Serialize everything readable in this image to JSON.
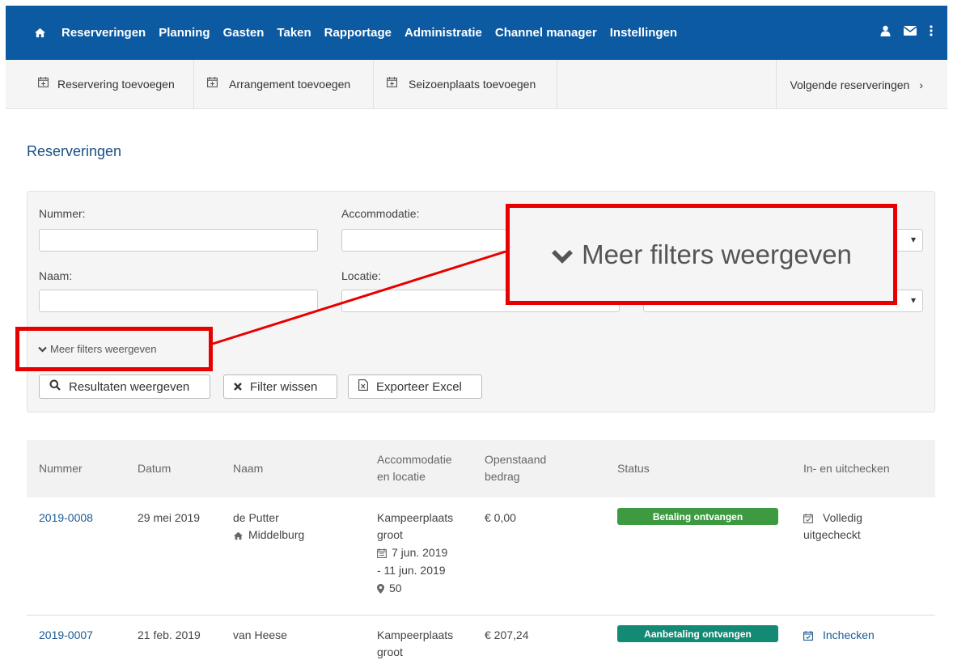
{
  "nav": {
    "items": [
      "Reserveringen",
      "Planning",
      "Gasten",
      "Taken",
      "Rapportage",
      "Administratie",
      "Channel manager",
      "Instellingen"
    ]
  },
  "toolbar": {
    "add_reservation": "Reservering toevoegen",
    "add_arrangement": "Arrangement toevoegen",
    "add_season_place": "Seizoenplaats toevoegen",
    "next_reservations": "Volgende reserveringen"
  },
  "page": {
    "title": "Reserveringen"
  },
  "filters": {
    "nummer_label": "Nummer:",
    "accommodatie_label": "Accommodatie:",
    "naam_label": "Naam:",
    "locatie_label": "Locatie:",
    "more_filters": "Meer filters weergeven",
    "show_results": "Resultaten weergeven",
    "clear_filter": "Filter wissen",
    "export_excel": "Exporteer Excel"
  },
  "callout": {
    "text": "Meer filters weergeven"
  },
  "table": {
    "headers": {
      "nummer": "Nummer",
      "datum": "Datum",
      "naam": "Naam",
      "accommodatie_1": "Accommodatie",
      "accommodatie_2": "en locatie",
      "openstaand_1": "Openstaand",
      "openstaand_2": "bedrag",
      "status": "Status",
      "checkin": "In- en uitchecken"
    },
    "rows": [
      {
        "nummer": "2019-0008",
        "datum": "29 mei 2019",
        "naam": "de Putter",
        "plaats": "Middelburg",
        "accommodatie_1": "Kampeerplaats",
        "accommodatie_2": "groot",
        "periode_1": "7 jun. 2019",
        "periode_2": "- 11 jun. 2019",
        "locatie": "50",
        "bedrag": "€ 0,00",
        "status": "Betaling ontvangen",
        "status_color": "#3d9a41",
        "checkin_1": "Volledig",
        "checkin_2": "uitgecheckt"
      },
      {
        "nummer": "2019-0007",
        "datum": "21 feb. 2019",
        "naam": "van Heese",
        "accommodatie_1": "Kampeerplaats",
        "accommodatie_2": "groot",
        "bedrag": "€ 207,24",
        "status": "Aanbetaling ontvangen",
        "status_color": "#138a74",
        "checkin": "Inchecken"
      }
    ]
  },
  "colors": {
    "nav_bg": "#0b5aa2",
    "highlight": "#e60000",
    "link": "#1a5a96"
  }
}
